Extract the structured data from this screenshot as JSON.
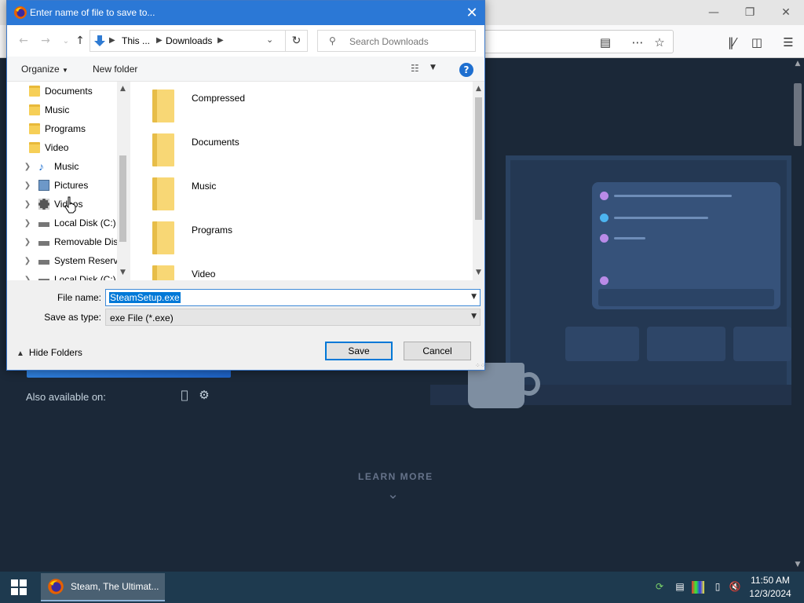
{
  "dialog": {
    "title": "Enter name of file to save to...",
    "breadcrumb": [
      "This ...",
      "Downloads"
    ],
    "search_placeholder": "Search Downloads",
    "toolbar": {
      "organize": "Organize",
      "new_folder": "New folder",
      "help": "?"
    },
    "tree": [
      {
        "label": "Documents",
        "icon": "folder-icon",
        "indent": 2
      },
      {
        "label": "Music",
        "icon": "folder-icon",
        "indent": 2
      },
      {
        "label": "Programs",
        "icon": "folder-icon",
        "indent": 2
      },
      {
        "label": "Video",
        "icon": "folder-icon",
        "indent": 2
      },
      {
        "label": "Music",
        "icon": "music-icon",
        "indent": 1
      },
      {
        "label": "Pictures",
        "icon": "pictures-icon",
        "indent": 1
      },
      {
        "label": "Videos",
        "icon": "videos-icon",
        "indent": 1
      },
      {
        "label": "Local Disk (C:)",
        "icon": "drive-icon",
        "indent": 1
      },
      {
        "label": "Removable Dis",
        "icon": "drive-icon",
        "indent": 1
      },
      {
        "label": "System Reserve",
        "icon": "drive-icon",
        "indent": 1
      },
      {
        "label": "Local Disk (C:)",
        "icon": "drive-icon",
        "indent": 1
      }
    ],
    "files": [
      "Compressed",
      "Documents",
      "Music",
      "Programs",
      "Video"
    ],
    "file_name_label": "File name:",
    "file_name_value": "SteamSetup.exe",
    "save_type_label": "Save as type:",
    "save_type_value": "exe File (*.exe)",
    "hide_folders": "Hide Folders",
    "save": "Save",
    "cancel": "Cancel"
  },
  "page": {
    "also_available": "Also available on:",
    "learn_more": "LEARN MORE"
  },
  "taskbar": {
    "task_label": "Steam, The Ultimat...",
    "time": "11:50 AM",
    "date": "12/3/2024"
  },
  "colors": {
    "dialog_title": "#2b78d6",
    "page_bg": "#1b2838",
    "taskbar": "#1e3a4f",
    "selection": "#0078d7"
  }
}
